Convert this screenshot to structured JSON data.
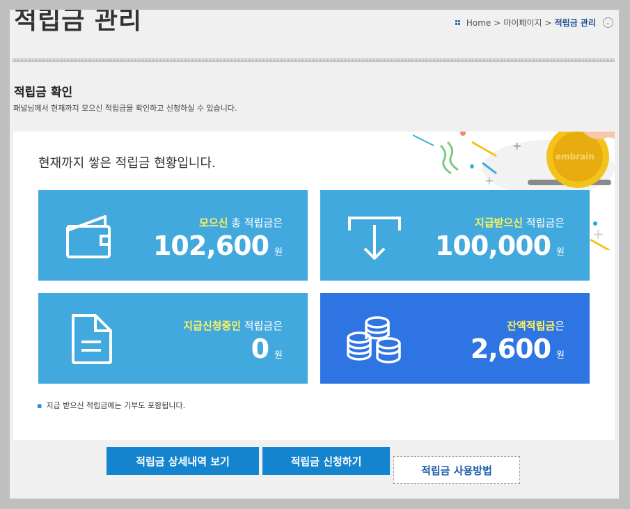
{
  "header": {
    "title": "적립금 관리",
    "breadcrumb": [
      "Home",
      ">",
      "마이페이지",
      ">",
      "적립금 관리"
    ]
  },
  "section": {
    "title": "적립금 확인",
    "description": "패널님께서 현재까지 모으신 적립금을 확인하고 신청하실 수 있습니다."
  },
  "panel": {
    "heading": "현재까지 쌓은 적립금 현황입니다.",
    "badge_text": "embrain",
    "cards": [
      {
        "icon": "wallet-icon",
        "highlight": "모으신",
        "caption": " 총 적립금은",
        "amount": "102,600",
        "unit": "원",
        "color": "#41a9de"
      },
      {
        "icon": "download-arrow-icon",
        "highlight": "지급받으신",
        "caption": " 적립금은",
        "amount": "100,000",
        "unit": "원",
        "color": "#41a9de"
      },
      {
        "icon": "document-icon",
        "highlight": "지급신청중인",
        "caption": " 적립금은",
        "amount": "0",
        "unit": "원",
        "color": "#41a9de"
      },
      {
        "icon": "coins-icon",
        "highlight": "잔액적립금",
        "caption": "은",
        "amount": "2,600",
        "unit": "원",
        "color": "#2f74e3"
      }
    ],
    "note": "지급 받으신 적립금에는 기부도 포함됩니다."
  },
  "buttons": {
    "history": "적립금 상세내역 보기",
    "request": "적립금 신청하기",
    "guide": "적립금 사용방법"
  }
}
